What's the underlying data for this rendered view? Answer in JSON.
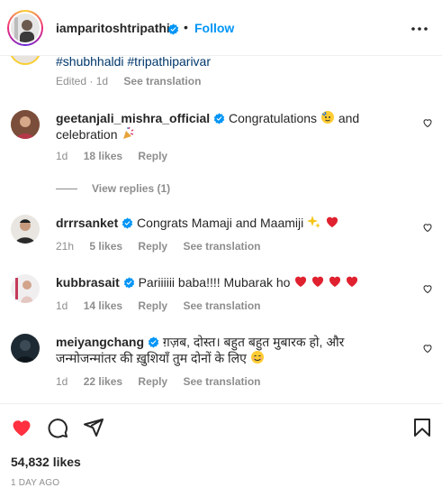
{
  "post_header": {
    "username": "iamparitoshtripathi",
    "separator": "•",
    "follow_label": "Follow"
  },
  "caption": {
    "tail_text": "#shubhhaldi #tripathiparivar",
    "meta_time": "Edited · 1d",
    "see_translation": "See translation"
  },
  "comments": [
    {
      "username": "geetanjali_mishra_official",
      "text_line1": "Congratulations",
      "text_and": "and",
      "text_line2": "celebration",
      "time": "1d",
      "likes": "18 likes",
      "reply": "Reply",
      "view_replies": "View replies (1)"
    },
    {
      "username": "drrrsanket",
      "text": "Congrats Mamaji and Maamiji",
      "time": "21h",
      "likes": "5 likes",
      "reply": "Reply",
      "see_translation": "See translation"
    },
    {
      "username": "kubbrasait",
      "text": "Pariiiiii baba!!!! Mubarak ho",
      "time": "1d",
      "likes": "14 likes",
      "reply": "Reply",
      "see_translation": "See translation"
    },
    {
      "username": "meiyangchang",
      "text_line1": "ग़ज़ब, दोस्त। बहुत बहुत मुबारक हो, और",
      "text_line2": "जन्मोजन्मांतर की ख़ुशियाँ तुम दोनों के लिए",
      "time": "1d",
      "likes": "22 likes",
      "reply": "Reply",
      "see_translation": "See translation"
    }
  ],
  "footer": {
    "likes_count": "54,832 likes",
    "date": "1 DAY AGO"
  },
  "colors": {
    "follow_blue": "#0095f6",
    "like_red": "#ff3040",
    "verified_blue": "#0095f6",
    "muted_text": "#8e8e8e"
  },
  "icons": [
    "verified-badge-icon",
    "more-options-icon",
    "heart-outline-icon",
    "heart-filled-icon",
    "comment-icon",
    "share-icon",
    "bookmark-icon"
  ]
}
